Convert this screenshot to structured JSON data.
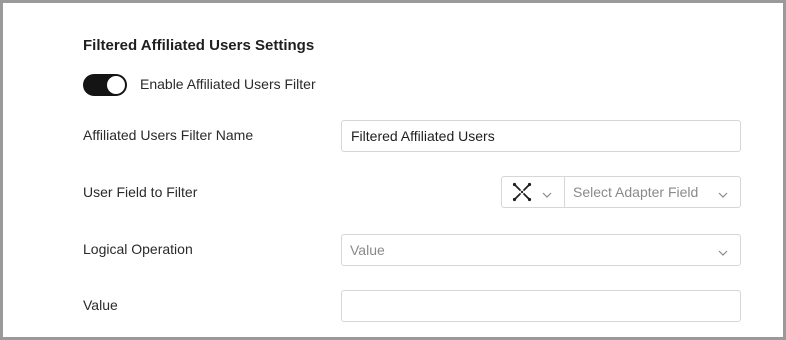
{
  "settings": {
    "title": "Filtered Affiliated Users Settings",
    "enable_filter": {
      "label": "Enable Affiliated Users Filter",
      "enabled": true
    },
    "filter_name": {
      "label": "Affiliated Users Filter Name",
      "value": "Filtered Affiliated Users"
    },
    "user_field": {
      "label": "User Field to Filter",
      "adapter_icon": "cross-arrows-icon",
      "placeholder": "Select Adapter Field"
    },
    "logical_operation": {
      "label": "Logical Operation",
      "placeholder": "Value"
    },
    "value": {
      "label": "Value",
      "value": ""
    }
  },
  "colors": {
    "toggle_on": "#141414",
    "border": "#d6d6d6",
    "frame": "#9a9a9a"
  }
}
